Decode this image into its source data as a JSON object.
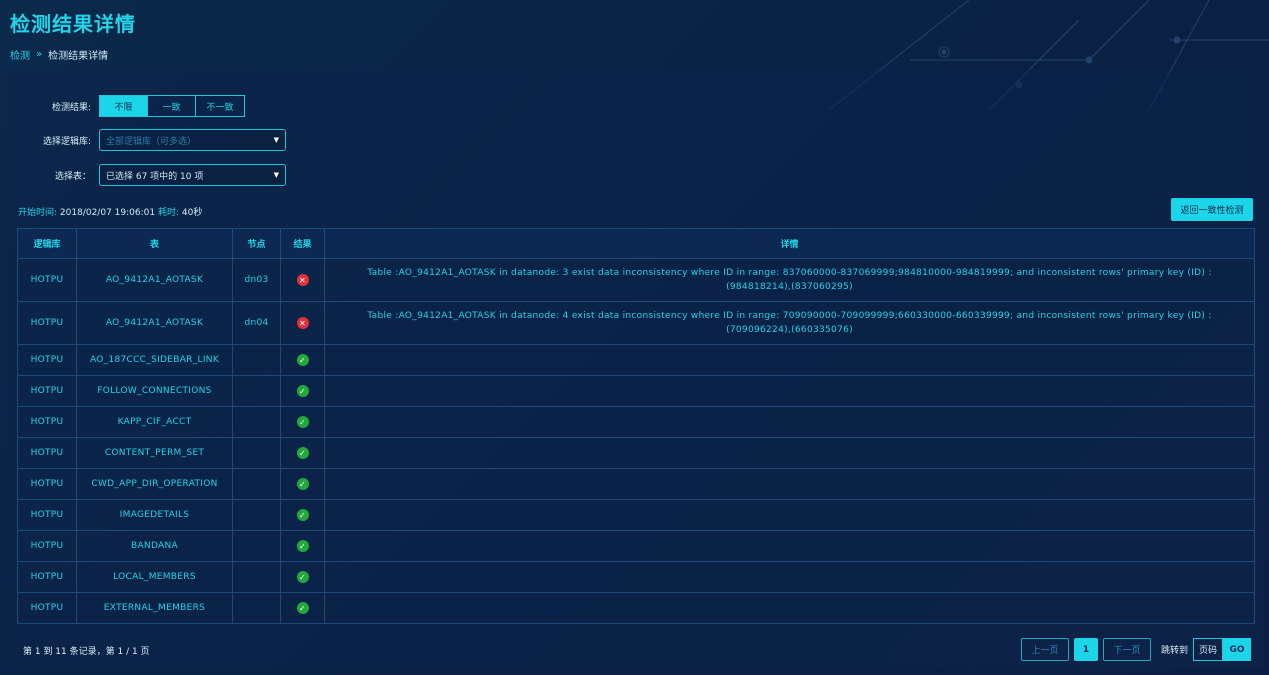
{
  "header": {
    "title": "检测结果详情",
    "breadcrumb": {
      "root": "检测",
      "separator": "»",
      "current": "检测结果详情"
    }
  },
  "filters": {
    "result_label": "检测结果:",
    "result_options": [
      "不限",
      "一致",
      "不一致"
    ],
    "result_selected": "不限",
    "logic_db_label": "选择逻辑库:",
    "logic_db_placeholder": "全部逻辑库（可多选）",
    "table_label": "选择表：",
    "table_value": "已选择 67 项中的 10 项"
  },
  "meta": {
    "start_label": "开始时间:",
    "start_time": "2018/02/07 19:06:01",
    "elapsed_label": "耗时:",
    "elapsed": "40秒"
  },
  "actions": {
    "return_button": "返回一致性检测"
  },
  "table": {
    "columns": [
      "逻辑库",
      "表",
      "节点",
      "结果",
      "详情"
    ],
    "rows": [
      {
        "db": "HOTPU",
        "table": "AO_9412A1_AOTASK",
        "node": "dn03",
        "result": "error",
        "detail": "Table :AO_9412A1_AOTASK in datanode: 3 exist data inconsistency where ID in range: 837060000-837069999;984810000-984819999; and inconsistent rows' primary key (ID) :(984818214),(837060295)"
      },
      {
        "db": "HOTPU",
        "table": "AO_9412A1_AOTASK",
        "node": "dn04",
        "result": "error",
        "detail": "Table :AO_9412A1_AOTASK in datanode: 4 exist data inconsistency where ID in range: 709090000-709099999;660330000-660339999; and inconsistent rows' primary key (ID) :(709096224),(660335076)"
      },
      {
        "db": "HOTPU",
        "table": "AO_187CCC_SIDEBAR_LINK",
        "node": "",
        "result": "ok",
        "detail": ""
      },
      {
        "db": "HOTPU",
        "table": "FOLLOW_CONNECTIONS",
        "node": "",
        "result": "ok",
        "detail": ""
      },
      {
        "db": "HOTPU",
        "table": "KAPP_CIF_ACCT",
        "node": "",
        "result": "ok",
        "detail": ""
      },
      {
        "db": "HOTPU",
        "table": "CONTENT_PERM_SET",
        "node": "",
        "result": "ok",
        "detail": ""
      },
      {
        "db": "HOTPU",
        "table": "CWD_APP_DIR_OPERATION",
        "node": "",
        "result": "ok",
        "detail": ""
      },
      {
        "db": "HOTPU",
        "table": "IMAGEDETAILS",
        "node": "",
        "result": "ok",
        "detail": ""
      },
      {
        "db": "HOTPU",
        "table": "BANDANA",
        "node": "",
        "result": "ok",
        "detail": ""
      },
      {
        "db": "HOTPU",
        "table": "LOCAL_MEMBERS",
        "node": "",
        "result": "ok",
        "detail": ""
      },
      {
        "db": "HOTPU",
        "table": "EXTERNAL_MEMBERS",
        "node": "",
        "result": "ok",
        "detail": ""
      }
    ]
  },
  "footer": {
    "record_info": "第 1 到 11 条记录，第 1 / 1 页",
    "prev": "上一页",
    "page": "1",
    "next": "下一页",
    "jump_label": "跳转到",
    "page_input_placeholder": "页码",
    "go": "GO"
  },
  "colors": {
    "accent": "#1ad6e8",
    "error": "#e0303a",
    "ok": "#23a83a",
    "background": "#0b2a4c"
  },
  "icons": {
    "error": "close-icon",
    "ok": "check-icon"
  }
}
